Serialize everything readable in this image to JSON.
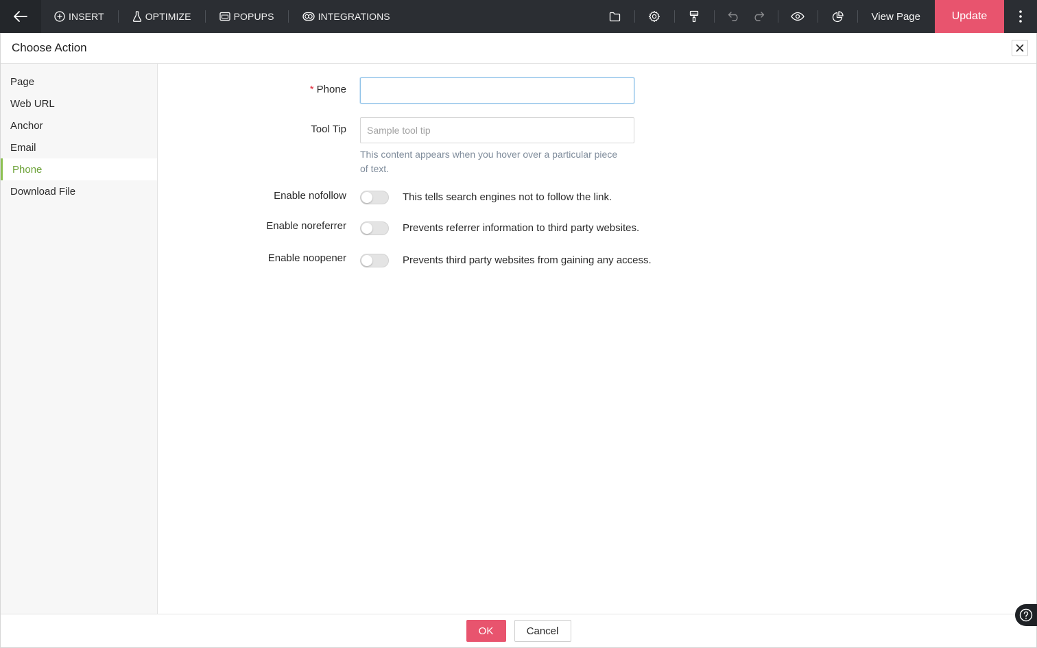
{
  "toolbar": {
    "insert_label": "INSERT",
    "optimize_label": "OPTIMIZE",
    "popups_label": "POPUPS",
    "integrations_label": "INTEGRATIONS",
    "view_page_label": "View Page",
    "update_label": "Update"
  },
  "dialog": {
    "title": "Choose Action",
    "sidebar": {
      "items": [
        {
          "label": "Page"
        },
        {
          "label": "Web URL"
        },
        {
          "label": "Anchor"
        },
        {
          "label": "Email"
        },
        {
          "label": "Phone",
          "active": true
        },
        {
          "label": "Download File"
        }
      ]
    },
    "form": {
      "phone_label": "Phone",
      "phone_required_mark": "*",
      "phone_value": "",
      "tooltip_label": "Tool Tip",
      "tooltip_placeholder": "Sample tool tip",
      "tooltip_help": "This content appears when you hover over a particular piece of text.",
      "toggles": [
        {
          "label": "Enable nofollow",
          "description": "This tells search engines not to follow the link.",
          "on": false
        },
        {
          "label": "Enable noreferrer",
          "description": "Prevents referrer information to third party websites.",
          "on": false
        },
        {
          "label": "Enable noopener",
          "description": "Prevents third party websites from gaining any access.",
          "on": false
        }
      ]
    },
    "footer": {
      "ok_label": "OK",
      "cancel_label": "Cancel"
    }
  },
  "colors": {
    "toolbar_bg": "#2b2e33",
    "accent": "#e8546e",
    "active_green": "#6ea33a"
  }
}
